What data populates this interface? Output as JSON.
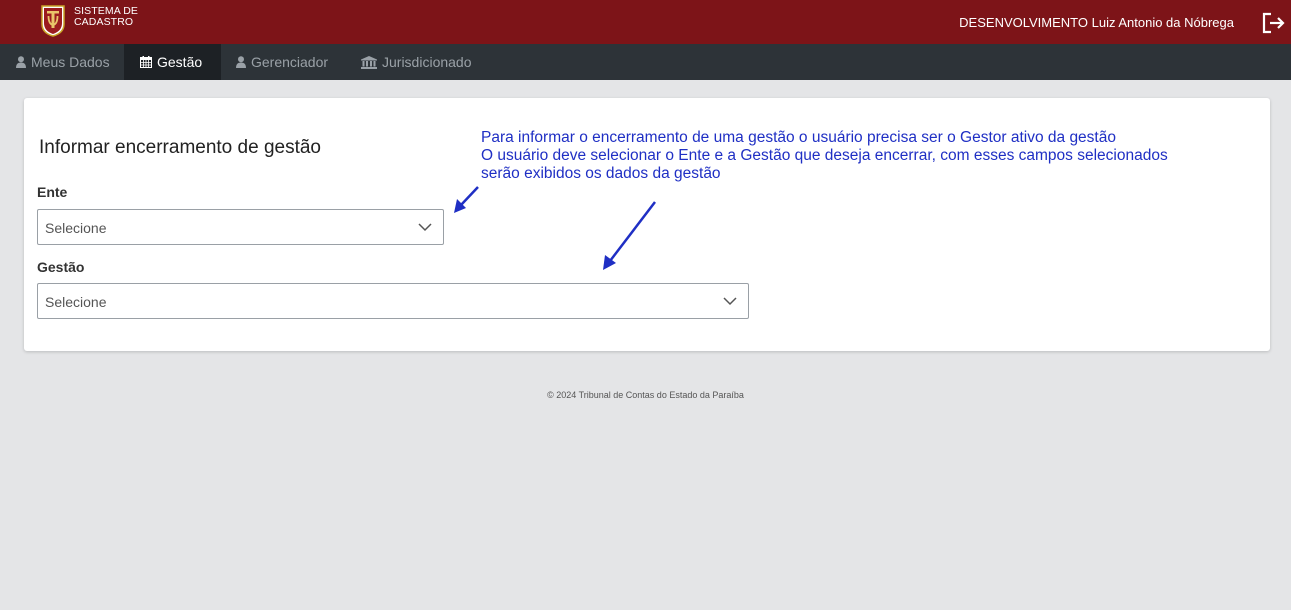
{
  "header": {
    "brand_line1": "SISTEMA DE",
    "brand_line2": "CADASTRO",
    "user": "DESENVOLVIMENTO Luiz Antonio da Nóbrega"
  },
  "nav": {
    "items": [
      {
        "label": "Meus Dados",
        "icon": "user-icon",
        "active": false
      },
      {
        "label": "Gestão",
        "icon": "calendar-icon",
        "active": true
      },
      {
        "label": "Gerenciador",
        "icon": "user-icon",
        "active": false
      },
      {
        "label": "Jurisdicionado",
        "icon": "institution-icon",
        "active": false
      }
    ]
  },
  "form": {
    "title": "Informar encerramento de gestão",
    "ente_label": "Ente",
    "ente_value": "Selecione",
    "gestao_label": "Gestão",
    "gestao_value": "Selecione"
  },
  "annotation": {
    "line1": "Para informar o encerramento de uma gestão o usuário precisa ser o Gestor ativo da gestão",
    "line2": "O usuário deve selecionar o Ente e a Gestão que deseja encerrar, com esses campos selecionados",
    "line3": "serão exibidos os dados da gestão",
    "color": "#1f2fc4"
  },
  "footer": {
    "text": "© 2024 Tribunal de Contas do Estado da Paraíba"
  },
  "colors": {
    "header": "#7d1418",
    "navbar": "#2d3338",
    "nav_active": "#1d2125",
    "background": "#e4e5e7"
  }
}
